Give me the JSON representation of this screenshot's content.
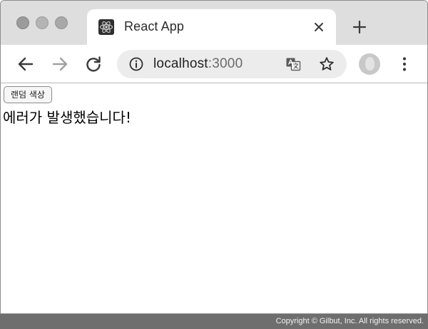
{
  "browser": {
    "tab": {
      "title": "React App",
      "favicon": "react-icon",
      "close_icon": "close-icon"
    },
    "new_tab_icon": "plus-icon",
    "toolbar": {
      "back_icon": "arrow-left-icon",
      "forward_icon": "arrow-right-icon",
      "reload_icon": "reload-icon",
      "url_host": "localhost",
      "url_port": ":3000",
      "info_icon": "info-icon",
      "translate_icon": "translate-icon",
      "bookmark_icon": "star-icon",
      "profile_icon": "avatar",
      "menu_icon": "kebab-menu-icon"
    }
  },
  "page": {
    "button_label": "랜덤 색상",
    "error_message": "에러가 발생했습니다!"
  },
  "footer": {
    "copyright": "Copyright © Gilbut, Inc. All rights reserved."
  },
  "colors": {
    "tabstrip_bg": "#dedede",
    "omnibox_bg": "#ececec",
    "footer_bg": "#6e6e6e"
  }
}
